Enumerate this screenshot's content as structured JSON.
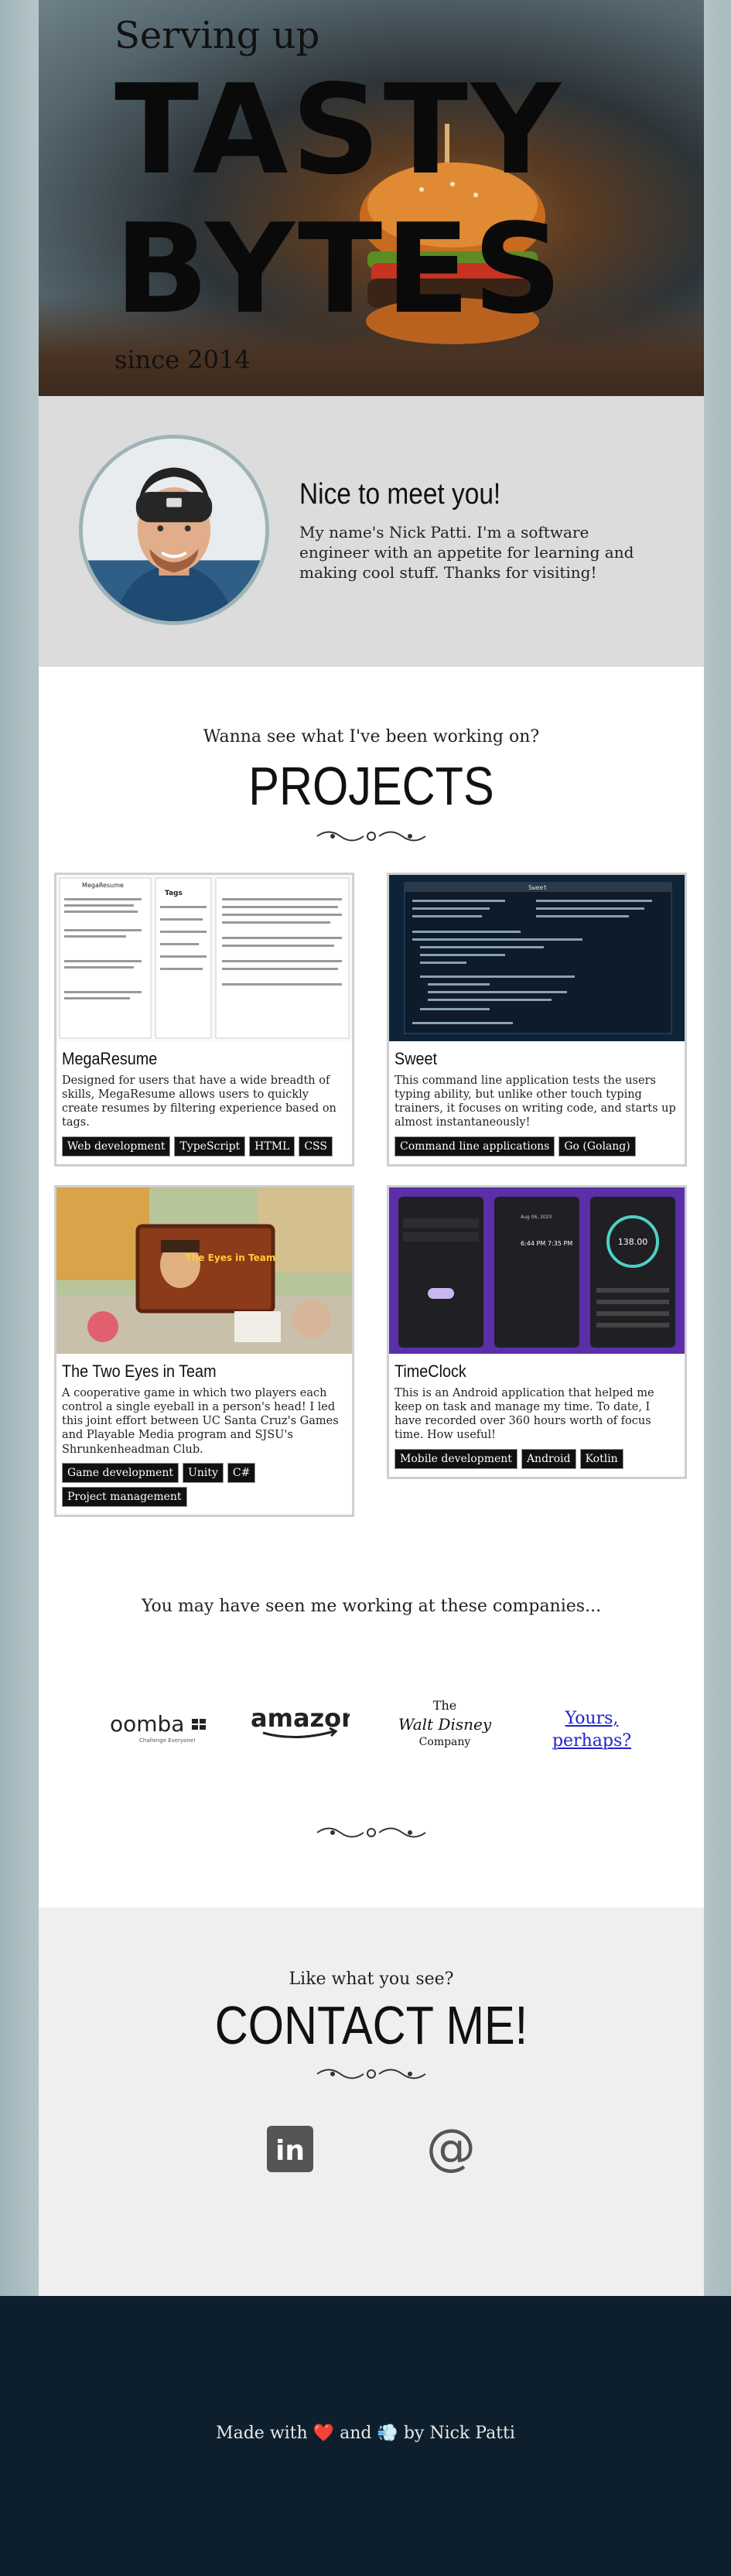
{
  "hero": {
    "line1": "Serving up",
    "word1": "TASTY",
    "word2": "BYTES",
    "line3": "since 2014"
  },
  "intro": {
    "heading": "Nice to meet you!",
    "text": "My name's Nick Patti. I'm a software engineer with an appetite for learning and making cool stuff. Thanks for visiting!"
  },
  "projects": {
    "subtitle": "Wanna see what I've been working on?",
    "title": "PROJECTS",
    "items": [
      {
        "title": "MegaResume",
        "description": "Designed for users that have a wide breadth of skills, MegaResume allows users to quickly create resumes by filtering experience based on tags.",
        "tags": [
          "Web development",
          "TypeScript",
          "HTML",
          "CSS"
        ]
      },
      {
        "title": "Sweet",
        "description": "This command line application tests the users typing ability, but unlike other touch typing trainers, it focuses on writing code, and starts up almost instantaneously!",
        "tags": [
          "Command line applications",
          "Go (Golang)"
        ]
      },
      {
        "title": "The Two Eyes in Team",
        "description": "A cooperative game in which two players each control a single eyeball in a person's head! I led this joint effort between UC Santa Cruz's Games and Playable Media program and SJSU's Shrunkenheadman Club.",
        "tags": [
          "Game development",
          "Unity",
          "C#",
          "Project management"
        ]
      },
      {
        "title": "TimeClock",
        "description": "This is an Android application that helped me keep on task and manage my time. To date, I have recorded over 360 hours worth of focus time. How useful!",
        "tags": [
          "Mobile development",
          "Android",
          "Kotlin"
        ]
      }
    ],
    "thumb_text": {
      "mega_header": "MegaResume",
      "mega_tags": "Tags",
      "sweet_header": "Sweet",
      "game_title": "The Eyes in Team",
      "timer_value": "138.00",
      "timer_1": "6:44 PM",
      "timer_2": "7:35 PM",
      "timer_date": "Aug 06, 2023"
    }
  },
  "companies": {
    "subtitle": "You may have seen me working at these companies...",
    "logos": {
      "oomba": "oomba",
      "oomba_sub": "Challenge Everyone!",
      "amazon": "amazon",
      "disney_the": "The",
      "disney_name": "Walt Disney",
      "disney_company": "Company"
    },
    "yours_link": "Yours, perhaps?"
  },
  "contact": {
    "subtitle": "Like what you see?",
    "title": "CONTACT ME!",
    "linkedin_icon": "linkedin-icon",
    "email_icon": "at-sign-icon",
    "linkedin_glyph": "in",
    "email_glyph": "@"
  },
  "footer": {
    "text": "Made with ❤️ and 💨 by Nick Patti"
  },
  "colors": {
    "footer_bg": "#0d1f2d",
    "tag_bg": "#111111",
    "link": "#2222cc"
  }
}
